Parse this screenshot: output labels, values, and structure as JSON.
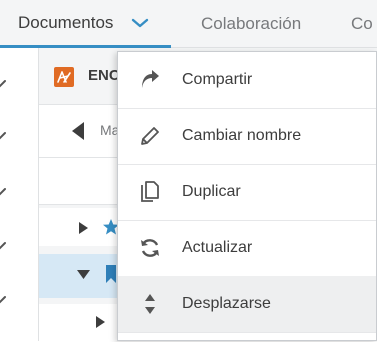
{
  "tabs": [
    {
      "label": "Documentos",
      "active": true
    },
    {
      "label": "Colaboración",
      "active": false
    },
    {
      "label": "Co",
      "active": false
    }
  ],
  "panel": {
    "title": "ENC",
    "nav_label": "Ma"
  },
  "menu": {
    "items": [
      {
        "label": "Compartir",
        "icon": "share-icon"
      },
      {
        "label": "Cambiar nombre",
        "icon": "pencil-icon"
      },
      {
        "label": "Duplicar",
        "icon": "duplicate-icon"
      },
      {
        "label": "Actualizar",
        "icon": "refresh-icon"
      },
      {
        "label": "Desplazarse",
        "icon": "move-icon",
        "highlighted": true
      }
    ]
  },
  "colors": {
    "accent": "#368ec4",
    "logo": "#e06b24",
    "selected_row": "#d6e8f5",
    "star": "#368ec4"
  }
}
